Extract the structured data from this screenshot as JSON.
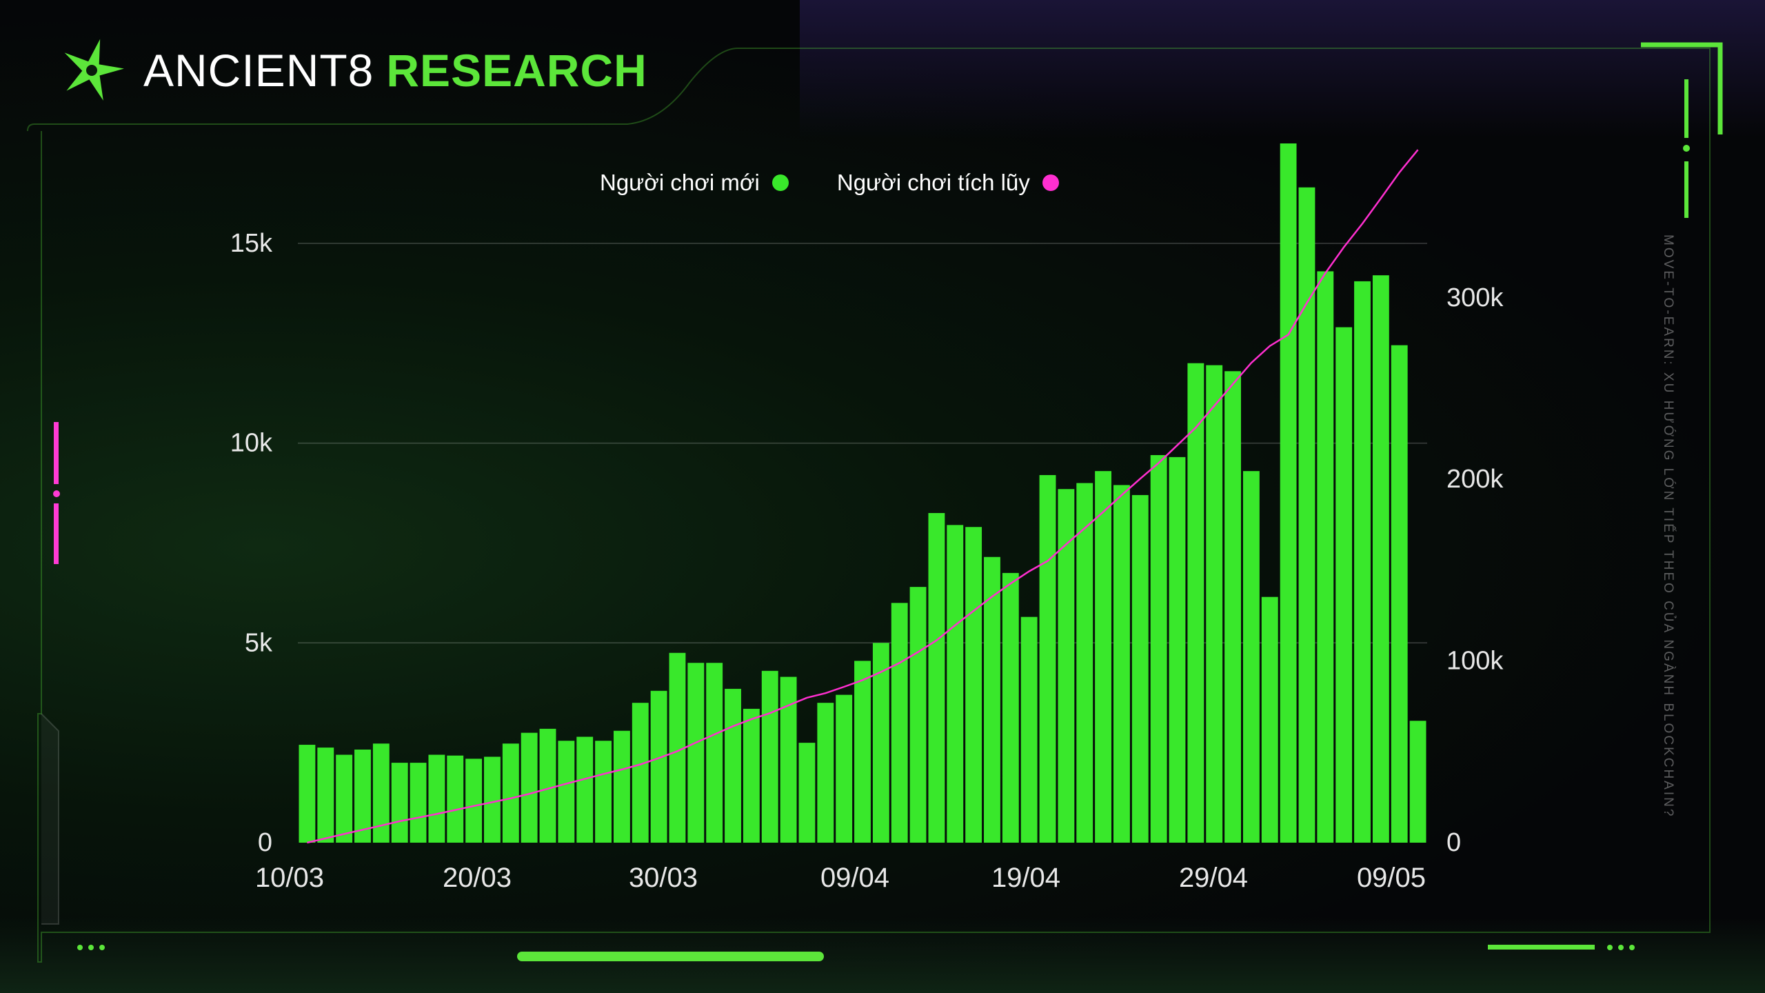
{
  "brand": {
    "name": "ANCIENT8",
    "accent": "RESEARCH"
  },
  "side_caption": "MOVE-TO-EARN: XU HƯỚNG LỚN TIẾP THEO CỦA NGÀNH BLOCKCHAIN?",
  "colors": {
    "new_players": "#39e82b",
    "cumulative": "#ff2fd0",
    "frame": "#5ce63a",
    "accent_pink": "#ff3bd4"
  },
  "icons": {
    "logo": "ancient8-star-icon"
  },
  "chart_data": {
    "type": "bar",
    "title": "",
    "x_tick_labels": [
      "10/03",
      "20/03",
      "30/03",
      "09/04",
      "19/04",
      "29/04",
      "09/05"
    ],
    "y_left": {
      "ticks": [
        "0",
        "5k",
        "10k",
        "15k"
      ],
      "tick_values": [
        0,
        5000,
        10000,
        15000
      ],
      "range": [
        0,
        17500
      ]
    },
    "y_right": {
      "ticks": [
        "0",
        "100k",
        "200k",
        "300k"
      ],
      "tick_values": [
        0,
        100000,
        200000,
        300000
      ],
      "range": [
        0,
        385000
      ]
    },
    "grid": true,
    "legend_position": "top",
    "x": [
      "10/03",
      "11/03",
      "12/03",
      "13/03",
      "14/03",
      "15/03",
      "16/03",
      "17/03",
      "18/03",
      "19/03",
      "20/03",
      "21/03",
      "22/03",
      "23/03",
      "24/03",
      "25/03",
      "26/03",
      "27/03",
      "28/03",
      "29/03",
      "30/03",
      "31/03",
      "01/04",
      "02/04",
      "03/04",
      "04/04",
      "05/04",
      "06/04",
      "07/04",
      "08/04",
      "09/04",
      "10/04",
      "11/04",
      "12/04",
      "13/04",
      "14/04",
      "15/04",
      "16/04",
      "17/04",
      "18/04",
      "19/04",
      "20/04",
      "21/04",
      "22/04",
      "23/04",
      "24/04",
      "25/04",
      "26/04",
      "27/04",
      "28/04",
      "29/04",
      "30/04",
      "01/05",
      "02/05",
      "03/05",
      "04/05",
      "05/05",
      "06/05",
      "07/05",
      "08/05",
      "09/05"
    ],
    "series": [
      {
        "name": "Người chơi mới",
        "type": "bar",
        "axis": "left",
        "values": [
          2450,
          2380,
          2200,
          2330,
          2480,
          2000,
          2000,
          2200,
          2180,
          2100,
          2150,
          2480,
          2750,
          2850,
          2550,
          2650,
          2550,
          2800,
          3500,
          3800,
          4750,
          4500,
          4500,
          3850,
          3350,
          4300,
          4150,
          2500,
          3500,
          3700,
          4550,
          5000,
          6000,
          6400,
          8250,
          7950,
          7900,
          7150,
          6750,
          5650,
          9200,
          8850,
          9000,
          9300,
          8950,
          8700,
          9700,
          9650,
          12000,
          11950,
          11800,
          9300,
          6150,
          17500,
          16400,
          14300,
          12900,
          14050,
          14200,
          12450,
          3050
        ]
      },
      {
        "name": "Người chơi tích lũy",
        "type": "line",
        "axis": "right",
        "values": [
          0,
          2400,
          4800,
          7100,
          9400,
          11800,
          13800,
          15800,
          18000,
          20200,
          22300,
          24400,
          26900,
          29700,
          32500,
          35100,
          37800,
          40300,
          43100,
          46600,
          50400,
          55100,
          59600,
          64100,
          68000,
          71300,
          75600,
          79800,
          82300,
          85800,
          89500,
          94000,
          99000,
          105000,
          111400,
          119700,
          127600,
          135500,
          142700,
          149400,
          155100,
          164300,
          173100,
          182100,
          191400,
          200400,
          209100,
          218800,
          228500,
          240500,
          252400,
          264200,
          273500,
          279700,
          297200,
          313600,
          327900,
          340800,
          354800,
          369000,
          381500
        ]
      }
    ]
  }
}
